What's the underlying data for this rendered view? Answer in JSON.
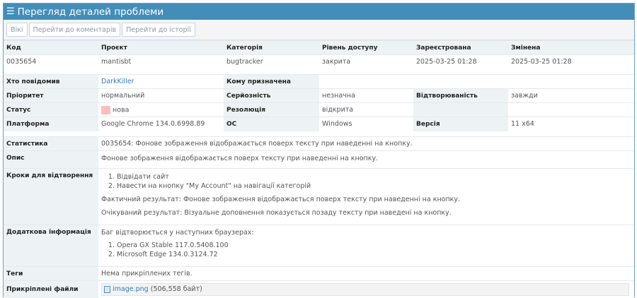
{
  "header": {
    "title": "Перегляд деталей проблеми"
  },
  "toolbar": {
    "wiki": "Вікі",
    "comments": "Перейти до коментарів",
    "history": "Перейти до історії"
  },
  "summary": {
    "headers": [
      "Код",
      "Проєкт",
      "Категорія",
      "Рівень доступу",
      "Зареєстрована",
      "Змінена"
    ],
    "values": [
      "0035654",
      "mantisbt",
      "bugtracker",
      "закрита",
      "2025-03-25 01:28",
      "2025-03-25 01:28"
    ]
  },
  "details": {
    "reporter_label": "Хто повідомив",
    "reporter": "DarkKiller",
    "assigned_label": "Кому призначена",
    "priority_label": "Пріоритет",
    "priority": "нормальний",
    "severity_label": "Серйозність",
    "severity": "незначна",
    "repro_label": "Відтворюваність",
    "repro": "завжди",
    "status_label": "Статус",
    "status": "нова",
    "status_color": "#fcbdbd",
    "resolution_label": "Резолюція",
    "resolution": "відкрита",
    "platform_label": "Платформа",
    "platform": "Google Chrome 134.0.6998.89",
    "os_label": "ОС",
    "os": "Windows",
    "version_label": "Версія",
    "version": "11 x64"
  },
  "body": {
    "summary_label": "Статистика",
    "summary": "0035654: Фонове зображення відображається поверх тексту при наведенні на кнопку.",
    "desc_label": "Опис",
    "desc": "Фонове зображення відображається поверх тексту при наведенні на кнопку.",
    "steps_label": "Кроки для відтворення",
    "steps": [
      "Відвідати сайт",
      "Навести на кнопку \"My Account\" на навігації категорій"
    ],
    "actual": "Фактичний результат: Фонове зображення відображається поверх тексту при наведенні на кнопку.",
    "expected": "Очікуваний результат: Візуальне доповнення показується позаду тексту при наведені на кнопку.",
    "info_label": "Додаткова інформація",
    "info_intro": "Баг відтворюється у наступних браузерах:",
    "browsers": [
      "Opera GX Stable 117.0.5408.100",
      "Microsoft Edge 134.0.3124.72"
    ],
    "tags_label": "Теги",
    "tags": "Нема прикріплених тегів.",
    "files_label": "Прикріплені файли",
    "file_name": "image.png",
    "file_size": "(506,558 байт)"
  }
}
